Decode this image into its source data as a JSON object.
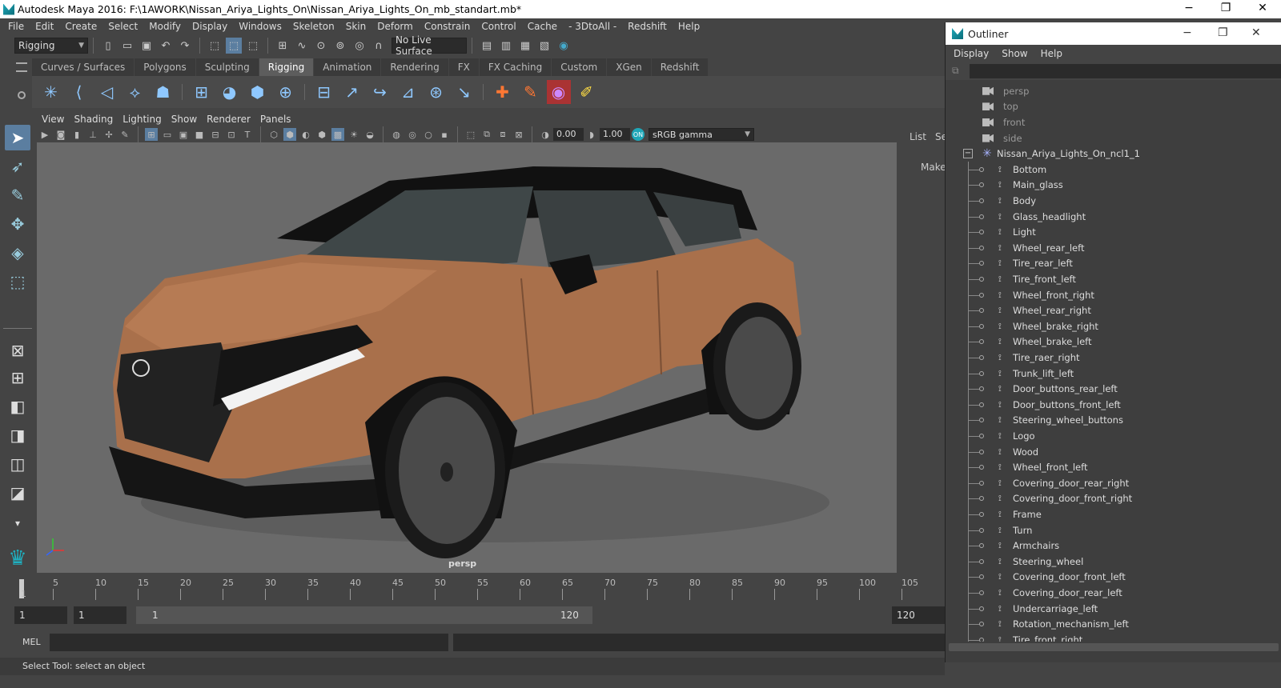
{
  "window": {
    "title": "Autodesk Maya 2016: F:\\1AWORK\\Nissan_Ariya_Lights_On\\Nissan_Ariya_Lights_On_mb_standart.mb*"
  },
  "menus": [
    "File",
    "Edit",
    "Create",
    "Select",
    "Modify",
    "Display",
    "Windows",
    "Skeleton",
    "Skin",
    "Deform",
    "Constrain",
    "Control",
    "Cache",
    "- 3DtoAll -",
    "Redshift",
    "Help"
  ],
  "status": {
    "mode": "Rigging",
    "live_surface": "No Live Surface"
  },
  "shelf_tabs": [
    "Curves / Surfaces",
    "Polygons",
    "Sculpting",
    "Rigging",
    "Animation",
    "Rendering",
    "FX",
    "FX Caching",
    "Custom",
    "XGen",
    "Redshift"
  ],
  "active_shelf": "Rigging",
  "panel_menu": [
    "View",
    "Shading",
    "Lighting",
    "Show",
    "Renderer",
    "Panels"
  ],
  "panel_toolbar": {
    "gamma_value": "0.00",
    "exposure_value": "1.00",
    "colorspace": "sRGB gamma"
  },
  "viewport": {
    "camera": "persp"
  },
  "right_strip": {
    "list": "List",
    "se": "Se",
    "make": "Make"
  },
  "timeline": {
    "ticks": [
      "5",
      "10",
      "15",
      "20",
      "25",
      "30",
      "35",
      "40",
      "45",
      "50",
      "55",
      "60",
      "65",
      "70",
      "75",
      "80",
      "85",
      "90",
      "95",
      "100",
      "105"
    ],
    "current": "1"
  },
  "range": {
    "start": "1",
    "start2": "1",
    "slider_start": "1",
    "slider_end": "120",
    "end": "120"
  },
  "mel": {
    "label": "MEL"
  },
  "help_line": "Select Tool: select an object",
  "outliner": {
    "title": "Outliner",
    "menu": [
      "Display",
      "Show",
      "Help"
    ],
    "cameras": [
      "persp",
      "top",
      "front",
      "side"
    ],
    "group": "Nissan_Ariya_Lights_On_ncl1_1",
    "children": [
      "Bottom",
      "Main_glass",
      "Body",
      "Glass_headlight",
      "Light",
      "Wheel_rear_left",
      "Tire_rear_left",
      "Tire_front_left",
      "Wheel_front_right",
      "Wheel_rear_right",
      "Wheel_brake_right",
      "Wheel_brake_left",
      "Tire_raer_right",
      "Trunk_lift_left",
      "Door_buttons_rear_left",
      "Door_buttons_front_left",
      "Steering_wheel_buttons",
      "Logo",
      "Wood",
      "Wheel_front_left",
      "Covering_door_rear_right",
      "Covering_door_front_right",
      "Frame",
      "Turn",
      "Armchairs",
      "Steering_wheel",
      "Covering_door_front_left",
      "Covering_door_rear_left",
      "Undercarriage_left",
      "Rotation_mechanism_left",
      "Tire_front_right"
    ]
  },
  "icons": {
    "window_min": "−",
    "window_max": "❐",
    "window_close": "✕",
    "collapse": "−"
  }
}
